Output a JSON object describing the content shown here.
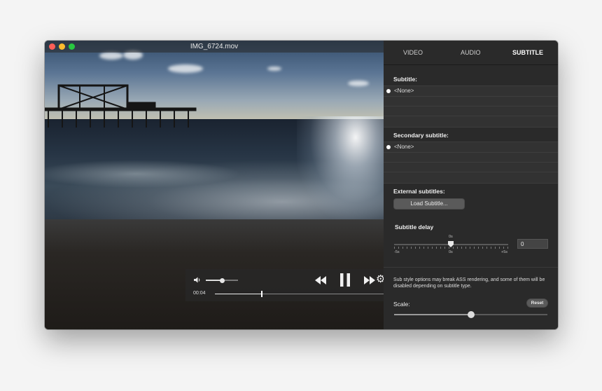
{
  "window": {
    "title": "IMG_6724.mov"
  },
  "player": {
    "current_time": "00:04",
    "progress": 0.28,
    "volume": 0.5
  },
  "panel": {
    "tabs": [
      {
        "label": "VIDEO",
        "active": false
      },
      {
        "label": "AUDIO",
        "active": false
      },
      {
        "label": "SUBTITLE",
        "active": true
      }
    ],
    "subtitle": {
      "heading": "Subtitle:",
      "selected": "<None>"
    },
    "secondary_subtitle": {
      "heading": "Secondary subtitle:",
      "selected": "<None>"
    },
    "external": {
      "heading": "External subtitles:",
      "button": "Load Subtitle..."
    },
    "delay": {
      "heading": "Subtitle delay",
      "center_label": "0s",
      "min_label": "-5s",
      "mid_label": "0s",
      "max_label": "+5s",
      "value": "0"
    },
    "note": "Sub style options may break ASS rendering, and some of them will be disabled depending on subtitle type.",
    "scale": {
      "label": "Scale:",
      "reset": "Reset",
      "value": 0.5
    }
  },
  "colors": {
    "close": "#ff5f57",
    "minimize": "#febc2e",
    "zoom": "#28c840"
  },
  "icons": [
    "volume-icon",
    "rewind-icon",
    "pause-icon",
    "fast-forward-icon",
    "gear-icon"
  ]
}
